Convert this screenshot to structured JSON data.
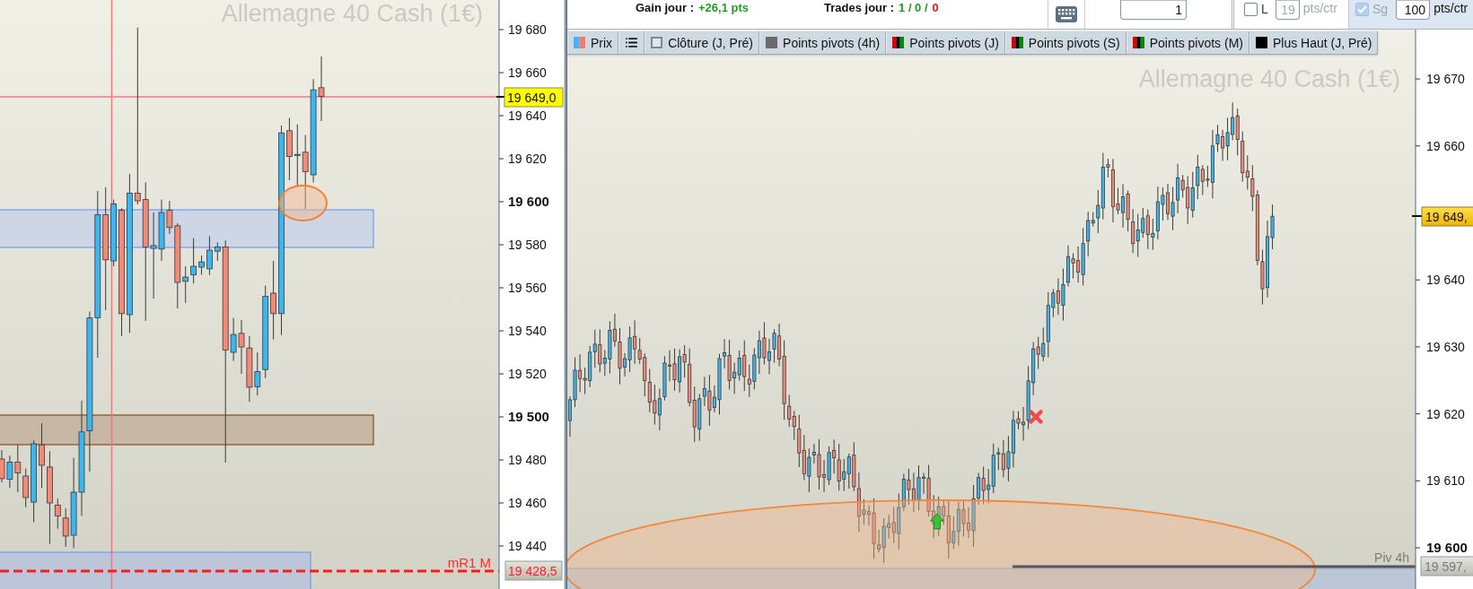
{
  "left_chart": {
    "title": "Allemagne 40 Cash (1€)",
    "axis_labels": [
      {
        "label": "19 680",
        "major": false
      },
      {
        "label": "19 660",
        "major": false
      },
      {
        "label": "19 640",
        "major": false
      },
      {
        "label": "19 620",
        "major": false
      },
      {
        "label": "19 600",
        "major": true
      },
      {
        "label": "19 580",
        "major": false
      },
      {
        "label": "19 560",
        "major": false
      },
      {
        "label": "19 540",
        "major": false
      },
      {
        "label": "19 520",
        "major": false
      },
      {
        "label": "19 500",
        "major": true
      },
      {
        "label": "19 480",
        "major": false
      },
      {
        "label": "19 460",
        "major": false
      },
      {
        "label": "19 440",
        "major": false
      }
    ],
    "last_price_tag": "19 649,0",
    "level_line": {
      "label": "mR1 M",
      "tag": "19 428,5"
    }
  },
  "order_bar": {
    "gain": {
      "label": "Gain jour :",
      "value": "+26,1 pts"
    },
    "trades": {
      "label": "Trades jour :",
      "parts": [
        {
          "text": "1 / 0 /",
          "color": "#1f9e1f"
        },
        {
          "text": "0",
          "color": "#e01b1b"
        }
      ]
    },
    "quantity": "1",
    "stops": [
      {
        "label": "L",
        "checked": false,
        "disabled": true,
        "value": "19",
        "unit": "pts/ctr"
      },
      {
        "label": "Sg",
        "checked": true,
        "disabled": false,
        "value": "100",
        "unit": "pts/ctr"
      }
    ]
  },
  "right_chart": {
    "legend": [
      {
        "kind": "split",
        "label": "Prix"
      },
      {
        "kind": "menu"
      },
      {
        "kind": "hollow",
        "label": "Clôture (J, Pré)"
      },
      {
        "kind": "solid",
        "label": "Points pivots (4h)",
        "color": "#6b6b6b"
      },
      {
        "kind": "tricolor",
        "label": "Points pivots (J)"
      },
      {
        "kind": "tricolor",
        "label": "Points pivots (S)"
      },
      {
        "kind": "tricolor",
        "label": "Points pivots (M)"
      },
      {
        "kind": "solid",
        "label": "Plus Haut (J, Pré)",
        "color": "#000000"
      }
    ],
    "title": "Allemagne 40 Cash (1€)",
    "axis_labels": [
      {
        "label": "19 670",
        "major": false
      },
      {
        "label": "19 660",
        "major": false
      },
      {
        "label": "19 640",
        "major": false
      },
      {
        "label": "19 630",
        "major": false
      },
      {
        "label": "19 620",
        "major": false
      },
      {
        "label": "19 610",
        "major": false
      },
      {
        "label": "19 600",
        "major": true
      }
    ],
    "last_price_tag": "19 649,",
    "pivot_line": {
      "label": "Piv 4h",
      "tag": "19 597,"
    }
  }
}
